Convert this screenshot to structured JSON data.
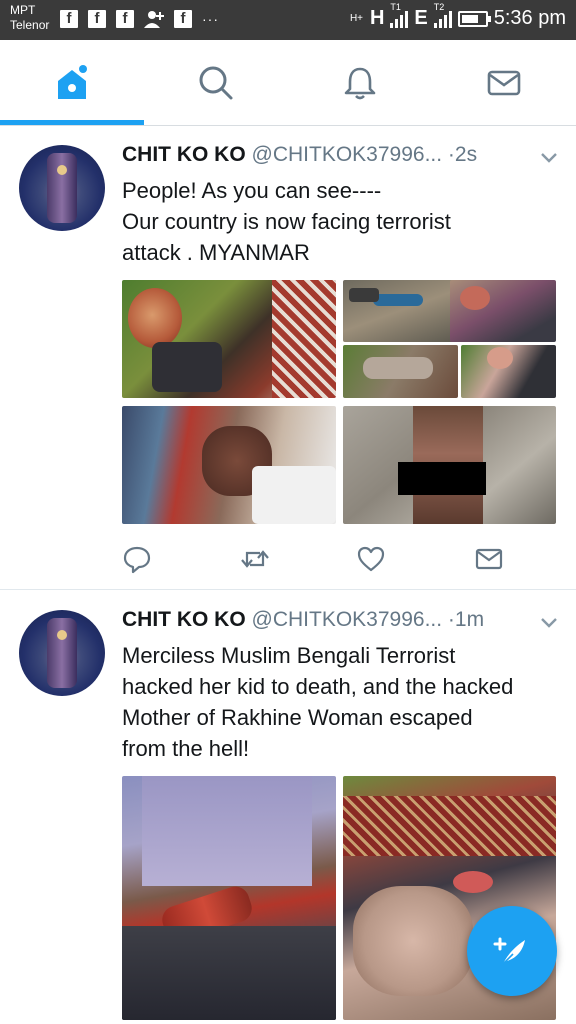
{
  "status_bar": {
    "carrier_top": "MPT",
    "carrier_bottom": "Telenor",
    "notifications": [
      "facebook-icon",
      "facebook-icon",
      "facebook-icon",
      "user-add-icon",
      "facebook-icon"
    ],
    "more": "···",
    "network_1": "H",
    "network_1_small": "H+",
    "network_1_sim": "T1",
    "network_2": "E",
    "network_2_sim": "T2",
    "time": "5:36 pm"
  },
  "nav": {
    "tabs": [
      "home-icon",
      "search-icon",
      "notifications-bell-icon",
      "messages-envelope-icon"
    ],
    "active_tab": 0
  },
  "tweets": [
    {
      "name": "CHIT KO KO",
      "handle": "@CHITKOK37996...",
      "separator": "·",
      "time": "2s",
      "text_lines": [
        "People! As you can  see----",
        "Our  country  is now facing terrorist",
        "attack . MYANMAR"
      ]
    },
    {
      "name": "CHIT KO KO",
      "handle": "@CHITKOK37996...",
      "separator": "·",
      "time": "1m",
      "text_lines": [
        "Merciless Muslim Bengali Terrorist",
        "hacked her kid to death, and the hacked",
        "Mother of Rakhine Woman escaped",
        "from the hell!"
      ]
    }
  ],
  "actions": [
    "reply-icon",
    "retweet-icon",
    "like-heart-icon",
    "direct-message-icon"
  ],
  "colors": {
    "accent": "#1da1f2",
    "status_bar": "#3a3a3a",
    "secondary_text": "#657786",
    "primary_text": "#14171a"
  }
}
